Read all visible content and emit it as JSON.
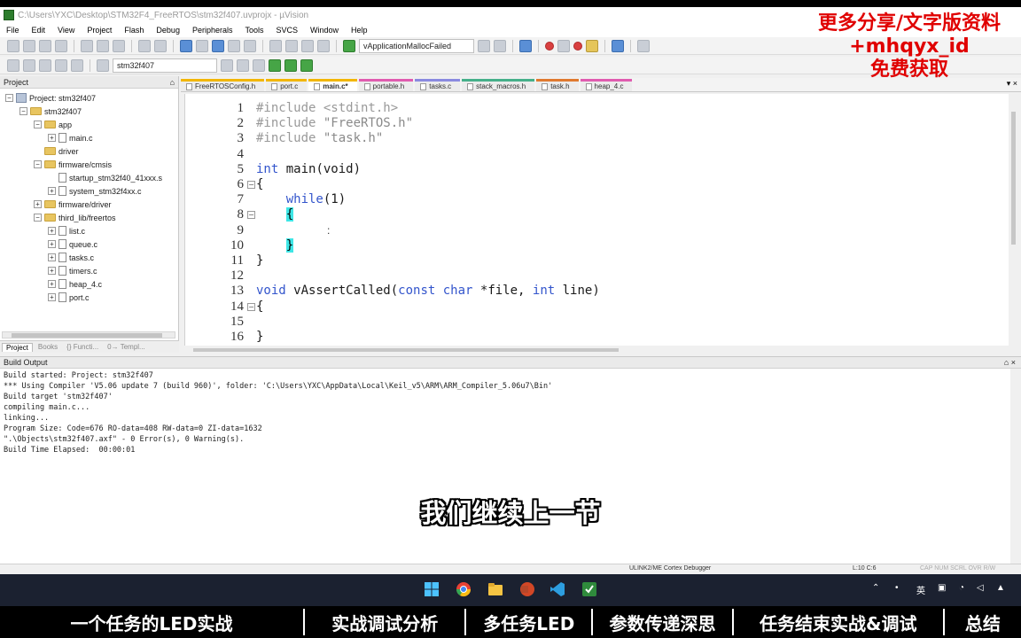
{
  "window": {
    "title": "C:\\Users\\YXC\\Desktop\\STM32F4_FreeRTOS\\stm32f407.uvprojx - µVision"
  },
  "menu": [
    "File",
    "Edit",
    "View",
    "Project",
    "Flash",
    "Debug",
    "Peripherals",
    "Tools",
    "SVCS",
    "Window",
    "Help"
  ],
  "toolbar": {
    "function_combo": "vApplicationMallocFailed",
    "target_combo": "stm32f407"
  },
  "project_panel": {
    "title": "Project",
    "pin": "⌂",
    "tree": [
      {
        "label": "Project: stm32f407",
        "level": 0,
        "kind": "project",
        "exp": "−"
      },
      {
        "label": "stm32f407",
        "level": 1,
        "kind": "folder",
        "exp": "−"
      },
      {
        "label": "app",
        "level": 2,
        "kind": "folder",
        "exp": "−"
      },
      {
        "label": "main.c",
        "level": 3,
        "kind": "file",
        "exp": "+"
      },
      {
        "label": "driver",
        "level": 2,
        "kind": "folder",
        "exp": ""
      },
      {
        "label": "firmware/cmsis",
        "level": 2,
        "kind": "folder",
        "exp": "−"
      },
      {
        "label": "startup_stm32f40_41xxx.s",
        "level": 3,
        "kind": "file",
        "exp": ""
      },
      {
        "label": "system_stm32f4xx.c",
        "level": 3,
        "kind": "file",
        "exp": "+"
      },
      {
        "label": "firmware/driver",
        "level": 2,
        "kind": "folder",
        "exp": "+"
      },
      {
        "label": "third_lib/freertos",
        "level": 2,
        "kind": "folder",
        "exp": "−"
      },
      {
        "label": "list.c",
        "level": 3,
        "kind": "file",
        "exp": "+"
      },
      {
        "label": "queue.c",
        "level": 3,
        "kind": "file",
        "exp": "+"
      },
      {
        "label": "tasks.c",
        "level": 3,
        "kind": "file",
        "exp": "+"
      },
      {
        "label": "timers.c",
        "level": 3,
        "kind": "file",
        "exp": "+"
      },
      {
        "label": "heap_4.c",
        "level": 3,
        "kind": "file",
        "exp": "+"
      },
      {
        "label": "port.c",
        "level": 3,
        "kind": "file",
        "exp": "+"
      }
    ],
    "tabs": [
      "Project",
      "Books",
      "{} Functi...",
      "0→ Templ..."
    ]
  },
  "editor": {
    "tabs": [
      {
        "label": "FreeRTOSConfig.h",
        "color": "#f2b600"
      },
      {
        "label": "port.c",
        "color": "#f2b600"
      },
      {
        "label": "main.c*",
        "color": "#f2b600",
        "active": true
      },
      {
        "label": "portable.h",
        "color": "#e05cb0"
      },
      {
        "label": "tasks.c",
        "color": "#8a8ae0"
      },
      {
        "label": "stack_macros.h",
        "color": "#46b08a"
      },
      {
        "label": "task.h",
        "color": "#e07a30"
      },
      {
        "label": "heap_4.c",
        "color": "#e05cb0"
      }
    ],
    "close_glyph": "▾ ×",
    "lines": [
      {
        "n": "1",
        "fold": "",
        "parts": [
          [
            "pp",
            "#include <stdint.h>"
          ]
        ]
      },
      {
        "n": "2",
        "fold": "",
        "parts": [
          [
            "pp",
            "#include "
          ],
          [
            "str",
            "\"FreeRTOS.h\""
          ]
        ]
      },
      {
        "n": "3",
        "fold": "",
        "parts": [
          [
            "pp",
            "#include "
          ],
          [
            "str",
            "\"task.h\""
          ]
        ]
      },
      {
        "n": "4",
        "fold": "",
        "parts": []
      },
      {
        "n": "5",
        "fold": "",
        "parts": [
          [
            "kw",
            "int"
          ],
          [
            "",
            " main(void)"
          ]
        ]
      },
      {
        "n": "6",
        "fold": "−",
        "parts": [
          [
            "",
            "{"
          ]
        ]
      },
      {
        "n": "7",
        "fold": "",
        "parts": [
          [
            "",
            "    "
          ],
          [
            "kw",
            "while"
          ],
          [
            "",
            "(1)"
          ]
        ]
      },
      {
        "n": "8",
        "fold": "−",
        "parts": [
          [
            "",
            "    "
          ],
          [
            "hl",
            "{"
          ]
        ]
      },
      {
        "n": "9",
        "fold": "",
        "parts": [
          [
            "",
            "        "
          ]
        ]
      },
      {
        "n": "10",
        "fold": "",
        "parts": [
          [
            "",
            "    "
          ],
          [
            "hl",
            "}"
          ]
        ]
      },
      {
        "n": "11",
        "fold": "",
        "parts": [
          [
            "",
            "}"
          ]
        ]
      },
      {
        "n": "12",
        "fold": "",
        "parts": []
      },
      {
        "n": "13",
        "fold": "",
        "parts": [
          [
            "kw",
            "void"
          ],
          [
            "",
            " vAssertCalled("
          ],
          [
            "kw",
            "const"
          ],
          [
            "",
            " "
          ],
          [
            "kw",
            "char"
          ],
          [
            "",
            " *file, "
          ],
          [
            "kw",
            "int"
          ],
          [
            "",
            " line)"
          ]
        ]
      },
      {
        "n": "14",
        "fold": "−",
        "parts": [
          [
            "",
            "{"
          ]
        ]
      },
      {
        "n": "15",
        "fold": "",
        "parts": []
      },
      {
        "n": "16",
        "fold": "",
        "parts": [
          [
            "",
            "}"
          ]
        ]
      }
    ]
  },
  "build_output": {
    "title": "Build Output",
    "controls": "⌂ ×",
    "lines": [
      "Build started: Project: stm32f407",
      "*** Using Compiler 'V5.06 update 7 (build 960)', folder: 'C:\\Users\\YXC\\AppData\\Local\\Keil_v5\\ARM\\ARM_Compiler_5.06u7\\Bin'",
      "Build target 'stm32f407'",
      "compiling main.c...",
      "linking...",
      "Program Size: Code=676 RO-data=408 RW-data=0 ZI-data=1632",
      "\".\\Objects\\stm32f407.axf\" - 0 Error(s), 0 Warning(s).",
      "Build Time Elapsed:  00:00:01"
    ]
  },
  "status": {
    "debugger": "ULINK2/ME Cortex Debugger",
    "position": "L:10 C:6",
    "keys": "CAP  NUM  SCRL  OVR  R/W"
  },
  "tray": {
    "ime": "英"
  },
  "watermark": [
    "更多分享/文字版资料",
    "+mhqyx_id",
    "免费获取"
  ],
  "subtitle": "我们继续上一节",
  "chapters": [
    "一个任务的LED实战",
    "实战调试分析",
    "多任务LED",
    "参数传递深思",
    "任务结束实战&调试",
    "总结"
  ]
}
